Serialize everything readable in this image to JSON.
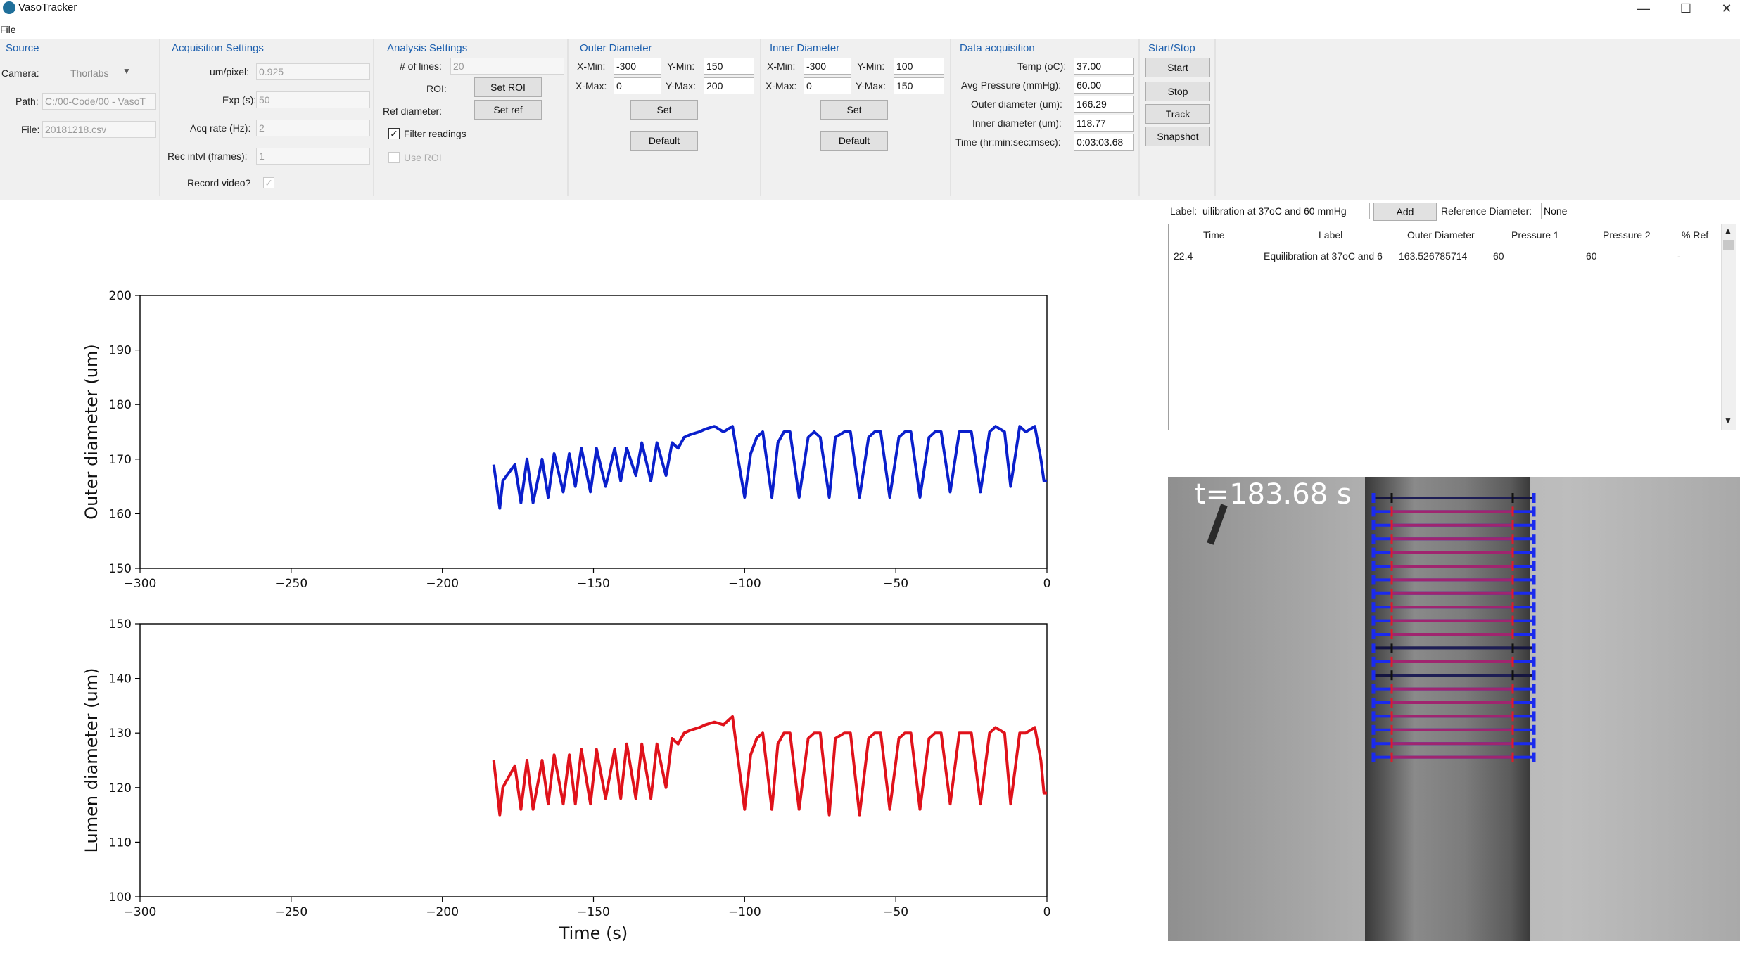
{
  "window": {
    "title": "VasoTracker",
    "menu_file": "File",
    "minimize_glyph": "—",
    "maximize_glyph": "☐",
    "close_glyph": "✕"
  },
  "source": {
    "title": "Source",
    "camera_label": "Camera:",
    "camera_value": "Thorlabs",
    "path_label": "Path:",
    "path_value": "C:/00-Code/00 - VasoT",
    "file_label": "File:",
    "file_value": "20181218.csv"
  },
  "acquisition": {
    "title": "Acquisition Settings",
    "umpixel_label": "um/pixel:",
    "umpixel_value": "0.925",
    "exp_label": "Exp (s):",
    "exp_value": "50",
    "acqrate_label": "Acq rate (Hz):",
    "acqrate_value": "2",
    "recintvl_label": "Rec intvl (frames):",
    "recintvl_value": "1",
    "recvideo_label": "Record video?",
    "recvideo_checked": true
  },
  "analysis": {
    "title": "Analysis Settings",
    "lines_label": "# of lines:",
    "lines_value": "20",
    "roi_label": "ROI:",
    "set_roi": "Set ROI",
    "refdiam_label": "Ref diameter:",
    "set_ref": "Set ref",
    "filter_label": "Filter readings",
    "filter_checked": true,
    "useroi_label": "Use ROI",
    "useroi_checked": false
  },
  "outer": {
    "title": "Outer Diameter",
    "xmin_label": "X-Min:",
    "xmin_value": "-300",
    "ymin_label": "Y-Min:",
    "ymin_value": "150",
    "xmax_label": "X-Max:",
    "xmax_value": "0",
    "ymax_label": "Y-Max:",
    "ymax_value": "200",
    "set": "Set",
    "default": "Default"
  },
  "inner": {
    "title": "Inner Diameter",
    "xmin_label": "X-Min:",
    "xmin_value": "-300",
    "ymin_label": "Y-Min:",
    "ymin_value": "100",
    "xmax_label": "X-Max:",
    "xmax_value": "0",
    "ymax_label": "Y-Max:",
    "ymax_value": "150",
    "set": "Set",
    "default": "Default"
  },
  "data_acq": {
    "title": "Data acquisition",
    "temp_label": "Temp (oC):",
    "temp_value": "37.00",
    "pressure_label": "Avg Pressure (mmHg):",
    "pressure_value": "60.00",
    "outer_label": "Outer diameter (um):",
    "outer_value": "166.29",
    "inner_label": "Inner diameter (um):",
    "inner_value": "118.77",
    "time_label": "Time (hr:min:sec:msec):",
    "time_value": "0:03:03.68"
  },
  "startstop": {
    "title": "Start/Stop",
    "start": "Start",
    "stop": "Stop",
    "track": "Track",
    "snapshot": "Snapshot"
  },
  "notes": {
    "label_label": "Label:",
    "label_value": "uilibration at 37oC and 60 mmHg",
    "add": "Add",
    "refdiam_label": "Reference Diameter:",
    "refdiam_value": "None",
    "columns": [
      "Time",
      "Label",
      "Outer Diameter",
      "Pressure 1",
      "Pressure 2",
      "% Ref"
    ],
    "rows": [
      [
        "22.4",
        "Equilibration at 37oC and 6",
        "163.526785714",
        "60",
        "60",
        "-"
      ]
    ]
  },
  "video": {
    "time_text": "t=183.68  s"
  },
  "chart_data": [
    {
      "type": "line",
      "title": "",
      "xlabel": "",
      "ylabel": "Outer diameter (um)",
      "xlim": [
        -300,
        0
      ],
      "ylim": [
        150,
        200
      ],
      "xticks": [
        -300,
        -250,
        -200,
        -150,
        -100,
        -50,
        0
      ],
      "xtick_labels": [
        "−300",
        "−250",
        "−200",
        "−150",
        "−100",
        "−50",
        "0"
      ],
      "yticks": [
        150,
        160,
        170,
        180,
        190,
        200
      ],
      "color": "#0a1fcc",
      "series": [
        {
          "x": [
            -183,
            -181,
            -180,
            -176,
            -174,
            -172,
            -170,
            -167,
            -165,
            -163,
            -160,
            -158,
            -156,
            -154,
            -151,
            -149,
            -146,
            -143,
            -141,
            -139,
            -136,
            -134,
            -131,
            -129,
            -126,
            -124,
            -122,
            -120,
            -118,
            -115,
            -113,
            -110,
            -107,
            -104,
            -100,
            -98,
            -96,
            -94,
            -91,
            -89,
            -87,
            -85,
            -82,
            -79,
            -77,
            -75,
            -72,
            -70,
            -67,
            -65,
            -62,
            -59,
            -57,
            -55,
            -52,
            -49,
            -47,
            -45,
            -42,
            -39,
            -37,
            -35,
            -32,
            -29,
            -27,
            -25,
            -22,
            -19,
            -17,
            -14,
            -12,
            -9,
            -7,
            -4,
            -2,
            -1,
            0
          ],
          "y": [
            169,
            161,
            166,
            169,
            162,
            170,
            162,
            170,
            163,
            171,
            164,
            171,
            165,
            172,
            164,
            172,
            165,
            172,
            166,
            172,
            167,
            173,
            166,
            173,
            167,
            173,
            172,
            174,
            174.5,
            175,
            175.5,
            176,
            175,
            176,
            163,
            171,
            174,
            175,
            163,
            173,
            175,
            175,
            163,
            174,
            175,
            174,
            163,
            174,
            175,
            175,
            163,
            174,
            175,
            175,
            163,
            174,
            175,
            175,
            163,
            174,
            175,
            175,
            164,
            175,
            175,
            175,
            164,
            175,
            176,
            175,
            165,
            176,
            175,
            176,
            170,
            166,
            166
          ]
        }
      ]
    },
    {
      "type": "line",
      "title": "",
      "xlabel": "Time (s)",
      "ylabel": "Lumen diameter (um)",
      "xlim": [
        -300,
        0
      ],
      "ylim": [
        100,
        150
      ],
      "xticks": [
        -300,
        -250,
        -200,
        -150,
        -100,
        -50,
        0
      ],
      "xtick_labels": [
        "−300",
        "−250",
        "−200",
        "−150",
        "−100",
        "−50",
        "0"
      ],
      "yticks": [
        100,
        110,
        120,
        130,
        140,
        150
      ],
      "color": "#e0121b",
      "series": [
        {
          "x": [
            -183,
            -181,
            -180,
            -176,
            -174,
            -172,
            -170,
            -167,
            -165,
            -163,
            -160,
            -158,
            -156,
            -154,
            -151,
            -149,
            -146,
            -143,
            -141,
            -139,
            -136,
            -134,
            -131,
            -129,
            -126,
            -124,
            -122,
            -120,
            -118,
            -115,
            -113,
            -110,
            -107,
            -104,
            -100,
            -98,
            -96,
            -94,
            -91,
            -89,
            -87,
            -85,
            -82,
            -79,
            -77,
            -75,
            -72,
            -70,
            -67,
            -65,
            -62,
            -59,
            -57,
            -55,
            -52,
            -49,
            -47,
            -45,
            -42,
            -39,
            -37,
            -35,
            -32,
            -29,
            -27,
            -25,
            -22,
            -19,
            -17,
            -14,
            -12,
            -9,
            -7,
            -4,
            -2,
            -1,
            0
          ],
          "y": [
            125,
            115,
            120,
            124,
            116,
            125,
            116,
            125,
            117,
            126,
            117,
            126,
            117,
            127,
            117,
            127,
            118,
            127,
            118,
            128,
            118,
            128,
            118,
            128,
            120,
            129,
            128,
            130,
            130.5,
            131,
            131.5,
            132,
            131.5,
            133,
            116,
            126,
            129,
            130,
            116,
            128,
            130,
            130,
            116,
            129,
            130,
            130,
            115,
            129,
            130,
            130,
            115,
            129,
            130,
            130,
            116,
            129,
            130,
            130,
            116,
            129,
            130,
            130,
            117,
            130,
            130,
            130,
            117,
            130,
            131,
            130,
            117,
            130,
            130,
            131,
            125,
            119,
            119
          ]
        }
      ]
    }
  ]
}
